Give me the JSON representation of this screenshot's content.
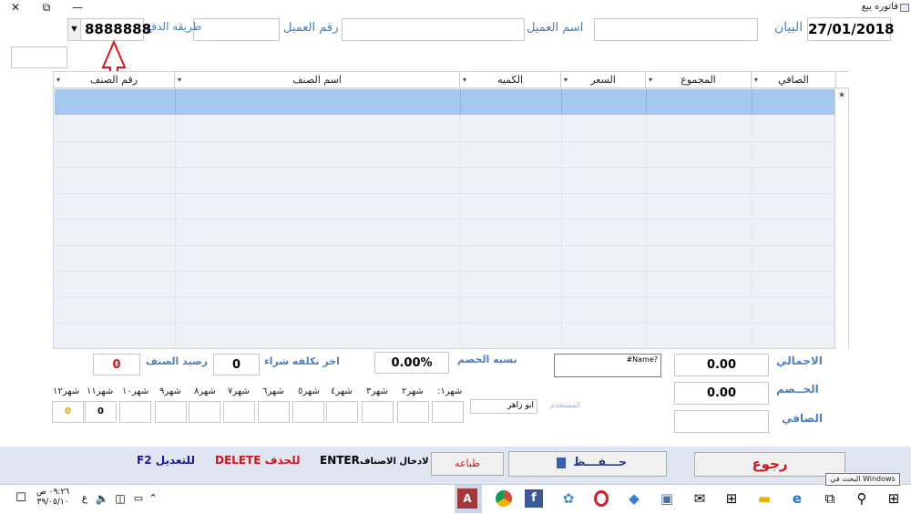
{
  "window": {
    "title": "فاتوره بيع",
    "controls": {
      "close": "✕",
      "restore": "⧉",
      "minimize": "—"
    }
  },
  "header": {
    "date_value": "27/01/2018",
    "statement_label": "البيان",
    "statement_value": "",
    "customer_name_label": "اسم العميل",
    "customer_name_value": "",
    "customer_number_label": "رقم العميل",
    "customer_number_value": "",
    "payment_label": "طريقه الدفع",
    "payment_value": "8888888",
    "extra_field_value": ""
  },
  "grid": {
    "columns": [
      "الصافي",
      "المجموع",
      "السعر",
      "الكميه",
      "اسم الصنف",
      "رقم الصنف"
    ],
    "new_row_marker": "*",
    "rows": []
  },
  "totals": {
    "total_label": "الاجمالي",
    "total_value": "0.00",
    "discount_label": "الخــصم",
    "discount_value": "0.00",
    "net_label": "الصافي",
    "net_value": "",
    "name_error_value": "#Name?",
    "discount_pct_label": "نسبه الخصم",
    "discount_pct_value": "0.00%",
    "last_cost_label": "اخر تكلفه شراء",
    "last_cost_value": "0",
    "item_balance_label": "رصيد الصنف",
    "item_balance_value": "0"
  },
  "user": {
    "label": "المستخدم",
    "value": "ابو زاهر"
  },
  "months": {
    "labels": [
      "شهر١:",
      "شهر٢",
      "شهر٣",
      "شهر٤",
      "شهر٥",
      "شهر٦",
      "شهر٧",
      "شهر٨",
      "شهر٩",
      "شهر١٠",
      "شهر١١",
      "شهر١٢"
    ],
    "values": [
      "",
      "",
      "",
      "",
      "",
      "",
      "",
      "",
      "",
      "",
      "0",
      "0"
    ]
  },
  "hints": {
    "edit_key": "F2",
    "edit_label": "للتعديل",
    "delete_key": "DELETE",
    "delete_label": "للحذف",
    "enter_key": "ENTER",
    "enter_label": "لادخال الاصناف"
  },
  "buttons": {
    "print": "طباعه",
    "save": "حـــفـــظ",
    "back": "رجوع"
  },
  "taskbar": {
    "search_tooltip": "البحث في Windows",
    "time": "٠٩:٢٦ ص",
    "date": "٣٩/٠٥/١٠",
    "lang": "ع"
  },
  "colors": {
    "label_blue": "#4a7fc4",
    "red": "#d6151b",
    "selected_row": "#a6c8ee",
    "grid_bg": "#edf1f7",
    "footer_bg": "#dfe6f1"
  }
}
